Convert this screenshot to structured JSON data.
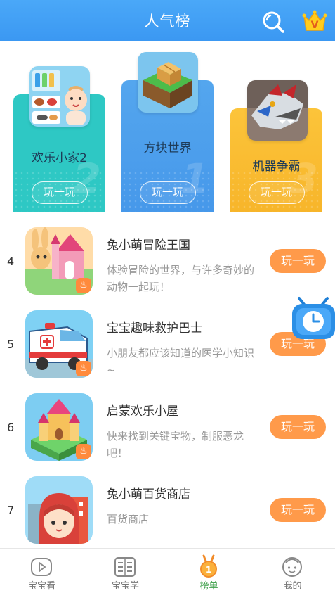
{
  "header": {
    "title": "人气榜",
    "search_icon": "search-icon",
    "vip_icon": "crown-vip-icon"
  },
  "colors": {
    "header_blue": "#4aa8f8",
    "play_orange": "#ff9a4a",
    "rank1": "#4f9fed",
    "rank2": "#2ec8c4",
    "rank3": "#f9bd33",
    "active_nav": "#3da04a"
  },
  "podium": [
    {
      "rank": "2",
      "name": "欢乐小家2",
      "button": "玩一玩"
    },
    {
      "rank": "1",
      "name": "方块世界",
      "button": "玩一玩"
    },
    {
      "rank": "3",
      "name": "机器争霸",
      "button": "玩一玩"
    }
  ],
  "list": [
    {
      "rank": "4",
      "title": "兔小萌冒险王国",
      "desc": "体验冒险的世界，与许多奇妙的动物一起玩！",
      "button": "玩一玩"
    },
    {
      "rank": "5",
      "title": "宝宝趣味救护巴士",
      "desc": "小朋友都应该知道的医学小知识~",
      "button": "玩一玩"
    },
    {
      "rank": "6",
      "title": "启蒙欢乐小屋",
      "desc": "快来找到关键宝物，制服恶龙吧！",
      "button": "玩一玩"
    },
    {
      "rank": "7",
      "title": "兔小萌百货商店",
      "desc": "百货商店",
      "button": "玩一玩"
    }
  ],
  "floating": {
    "icon": "clock-icon"
  },
  "nav": [
    {
      "label": "宝宝看",
      "icon": "tv-play-icon"
    },
    {
      "label": "宝宝学",
      "icon": "book-icon"
    },
    {
      "label": "榜单",
      "icon": "medal-icon",
      "active": true
    },
    {
      "label": "我的",
      "icon": "child-face-icon"
    }
  ]
}
